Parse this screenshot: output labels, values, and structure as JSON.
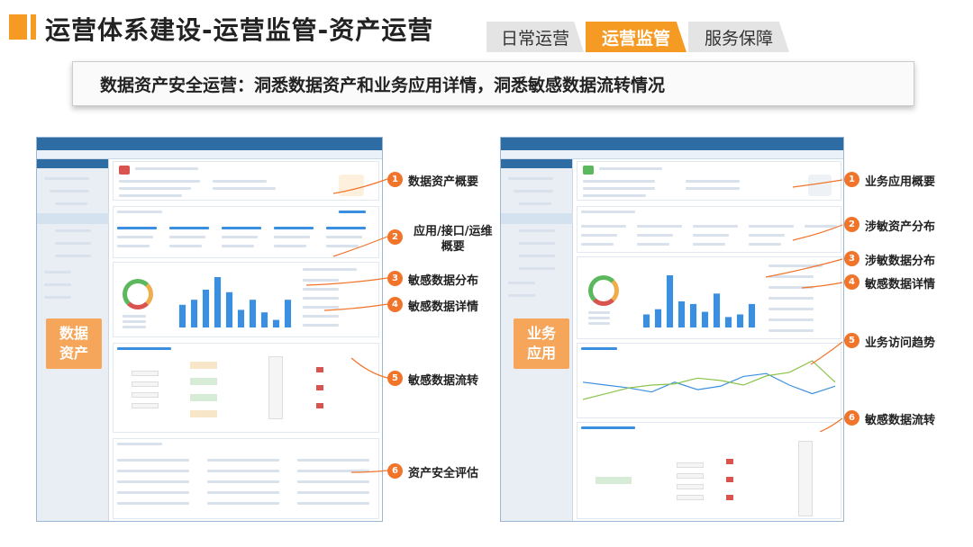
{
  "header": {
    "title": "运营体系建设-运营监管-资产运营",
    "tabs": [
      {
        "label": "日常运营",
        "active": false
      },
      {
        "label": "运营监管",
        "active": true
      },
      {
        "label": "服务保障",
        "active": false
      }
    ],
    "accent_color": "#f59a23"
  },
  "subtitle": {
    "lead": "数据资产安全运营：",
    "rest": "洞悉数据资产和业务应用详情，洞悉敏感数据流转情况"
  },
  "left_panel": {
    "box_label": "数据\n资产",
    "annotations": [
      {
        "num": "1",
        "text": "数据资产概要"
      },
      {
        "num": "2",
        "text": "应用/接口/运维\n概要"
      },
      {
        "num": "3",
        "text": "敏感数据分布"
      },
      {
        "num": "4",
        "text": "敏感数据详情"
      },
      {
        "num": "5",
        "text": "敏感数据流转"
      },
      {
        "num": "6",
        "text": "资产安全评估"
      }
    ]
  },
  "right_panel": {
    "box_label": "业务\n应用",
    "annotations": [
      {
        "num": "1",
        "text": "业务应用概要"
      },
      {
        "num": "2",
        "text": "涉敏资产分布"
      },
      {
        "num": "3",
        "text": "涉敏数据分布"
      },
      {
        "num": "4",
        "text": "敏感数据详情"
      },
      {
        "num": "5",
        "text": "业务访问趋势"
      },
      {
        "num": "6",
        "text": "敏感数据流转"
      }
    ]
  },
  "mini_left_bars": [
    0.45,
    0.55,
    0.75,
    1.0,
    0.7,
    0.35,
    0.55,
    0.3,
    0.15,
    0.55
  ],
  "mini_right_bars": [
    0.25,
    0.35,
    1.0,
    0.5,
    0.45,
    0.3,
    0.65,
    0.2,
    0.25,
    0.45
  ],
  "mini_line_a": [
    0.55,
    0.5,
    0.45,
    0.38,
    0.55,
    0.42,
    0.48,
    0.65,
    0.7,
    0.5,
    0.35,
    0.48
  ],
  "mini_line_b": [
    0.25,
    0.35,
    0.45,
    0.5,
    0.52,
    0.62,
    0.58,
    0.5,
    0.66,
    0.72,
    0.92,
    0.55
  ]
}
